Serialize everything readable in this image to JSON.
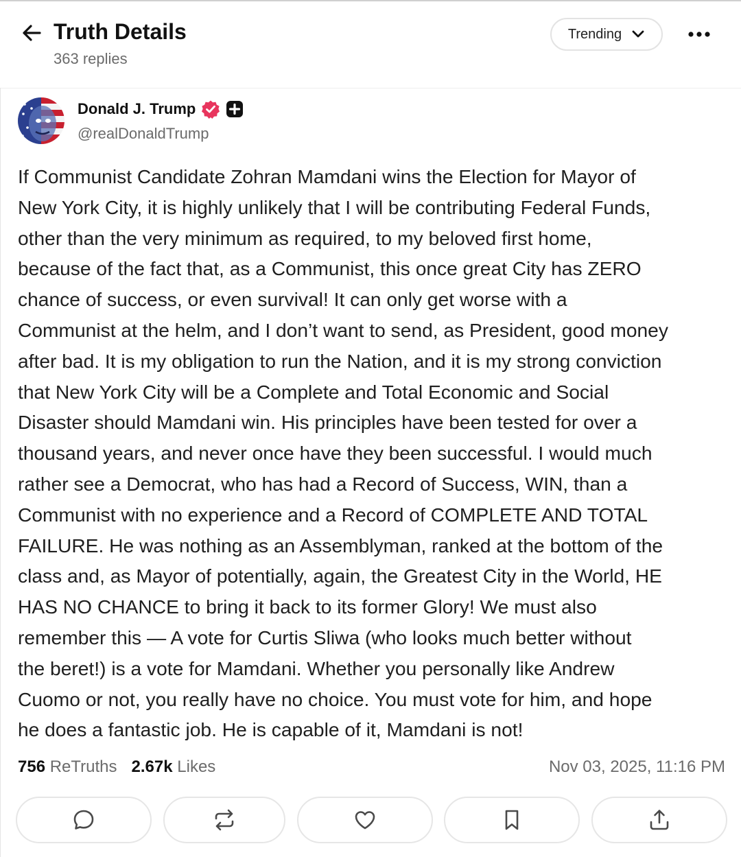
{
  "header": {
    "title": "Truth Details",
    "replies": "363 replies",
    "sort_label": "Trending"
  },
  "post": {
    "author_name": "Donald J. Trump",
    "handle": "@realDonaldTrump",
    "body": "If Communist Candidate Zohran Mamdani wins the Election for Mayor of\nNew York City, it is highly unlikely that I will be contributing Federal Funds,\nother than the very minimum as required, to my beloved first home,\nbecause of the fact that, as a Communist, this once great City has ZERO\nchance of success, or even survival! It can only get worse with a\nCommunist at the helm, and I don’t want to send, as President, good money\nafter bad. It is my obligation to run the Nation, and it is my strong conviction\nthat New York City will be a Complete and Total Economic and Social\nDisaster should Mamdani win. His principles have been tested for over a\nthousand years, and never once have they been successful. I would much\nrather see a Democrat, who has had a Record of Success, WIN, than a\nCommunist with no experience and a Record of COMPLETE AND TOTAL\nFAILURE. He was nothing as an Assemblyman, ranked at the bottom of the\nclass and, as Mayor of potentially, again, the Greatest City in the World, HE\nHAS NO CHANCE to bring it back to its former Glory! We must also\nremember this — A vote for Curtis Sliwa (who looks much better without\nthe beret!) is a vote for Mamdani. Whether you personally like Andrew\nCuomo or not, you really have no choice. You must vote for him, and hope\nhe does a fantastic job. He is capable of it, Mamdani is not!",
    "retruths_count": "756",
    "retruths_label": "ReTruths",
    "likes_count": "2.67k",
    "likes_label": "Likes",
    "timestamp": "Nov 03, 2025, 11:16 PM"
  },
  "icons": {
    "back": "arrow-left-icon",
    "sort": "chevron-down-icon",
    "more": "more-horizontal-icon",
    "verified": "verified-badge-icon",
    "premium": "plus-badge-icon",
    "reply": "comment-icon",
    "retruth": "repost-icon",
    "like": "heart-icon",
    "bookmark": "bookmark-icon",
    "share": "share-icon"
  },
  "colors": {
    "verified_badge": "#e8355d",
    "text_primary": "#111111",
    "text_secondary": "#6b6b6b",
    "border": "#e6e6e6"
  }
}
